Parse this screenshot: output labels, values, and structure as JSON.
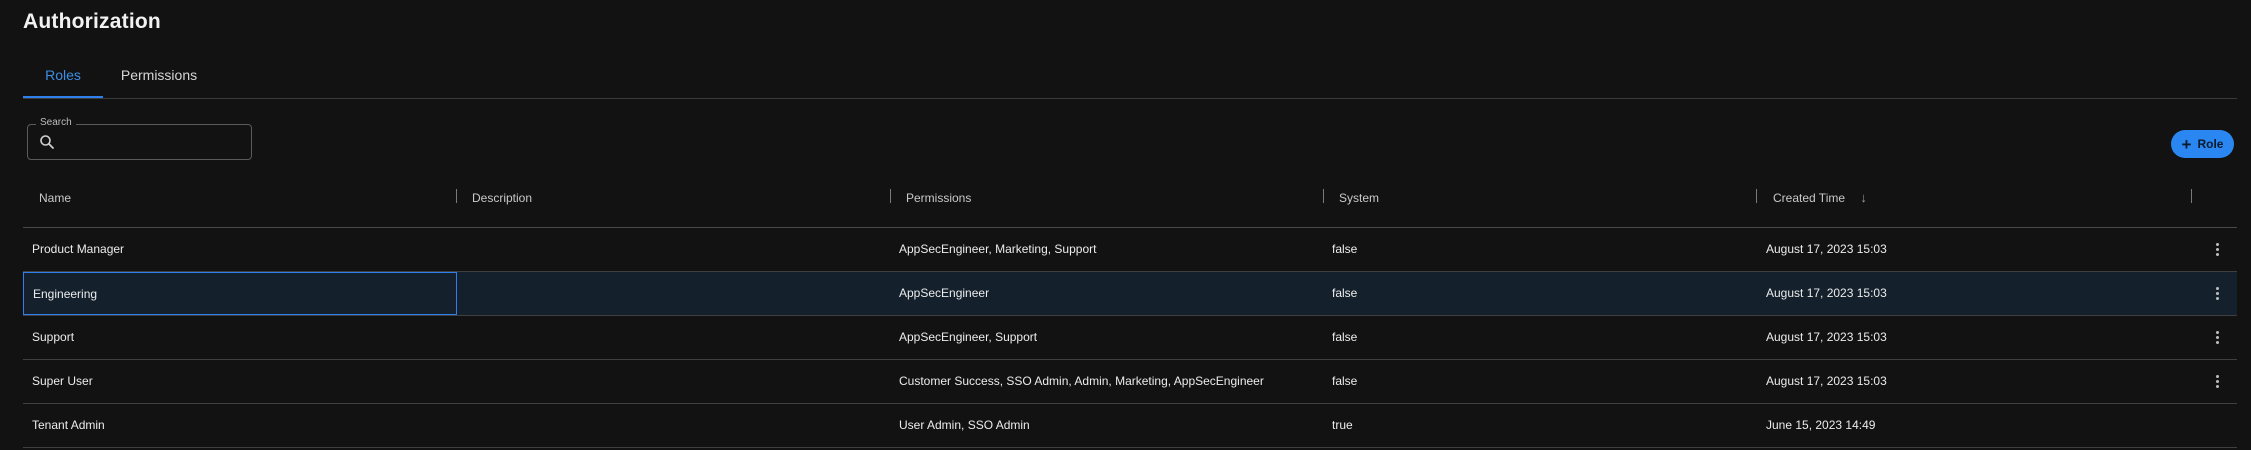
{
  "page": {
    "title": "Authorization"
  },
  "tabs": [
    {
      "label": "Roles",
      "active": true
    },
    {
      "label": "Permissions",
      "active": false
    }
  ],
  "search": {
    "label": "Search",
    "value": "",
    "placeholder": ""
  },
  "actions": {
    "add_role_label": "Role"
  },
  "table": {
    "columns": [
      "Name",
      "Description",
      "Permissions",
      "System",
      "Created Time"
    ],
    "sort": {
      "column": "Created Time",
      "direction": "desc"
    },
    "rows": [
      {
        "name": "Product Manager",
        "description": "",
        "permissions": "AppSecEngineer, Marketing, Support",
        "system": "false",
        "created": "August 17, 2023 15:03"
      },
      {
        "name": "Engineering",
        "description": "",
        "permissions": "AppSecEngineer",
        "system": "false",
        "created": "August 17, 2023 15:03"
      },
      {
        "name": "Support",
        "description": "",
        "permissions": "AppSecEngineer, Support",
        "system": "false",
        "created": "August 17, 2023 15:03"
      },
      {
        "name": "Super User",
        "description": "",
        "permissions": "Customer Success, SSO Admin, Admin, Marketing, AppSecEngineer",
        "system": "false",
        "created": "August 17, 2023 15:03"
      },
      {
        "name": "Tenant Admin",
        "description": "",
        "permissions": "User Admin, SSO Admin",
        "system": "true",
        "created": "June 15, 2023 14:49"
      }
    ]
  },
  "colors": {
    "accent": "#2f80ed",
    "background": "#121212",
    "selected_row": "#14202c"
  }
}
